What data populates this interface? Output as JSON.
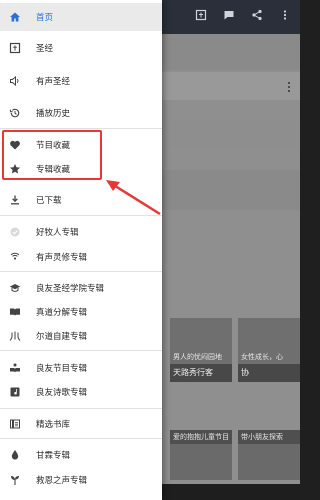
{
  "drawer": {
    "items": [
      {
        "label": "首页",
        "icon": "home-icon",
        "active": true
      },
      {
        "label": "圣经",
        "icon": "book-icon"
      },
      {
        "label": "有声圣经",
        "icon": "speaker-icon"
      },
      {
        "label": "播放历史",
        "icon": "history-icon"
      },
      {
        "label": "节目收藏",
        "icon": "heart-icon"
      },
      {
        "label": "专辑收藏",
        "icon": "star-icon"
      },
      {
        "label": "已下载",
        "icon": "download-icon"
      },
      {
        "label": "好牧人专辑",
        "icon": "shepherd-icon"
      },
      {
        "label": "有声灵修专辑",
        "icon": "radio-icon"
      },
      {
        "label": "良友圣经学院专辑",
        "icon": "graduation-cap-icon"
      },
      {
        "label": "真道分解专辑",
        "icon": "open-book-icon"
      },
      {
        "label": "尔道自建专辑",
        "icon": "script-icon"
      },
      {
        "label": "良友节目专辑",
        "icon": "reader-icon"
      },
      {
        "label": "良友诗歌专辑",
        "icon": "music-icon"
      },
      {
        "label": "精选书库",
        "icon": "library-icon"
      },
      {
        "label": "甘霖专辑",
        "icon": "drop-icon"
      },
      {
        "label": "救恩之声专辑",
        "icon": "sprout-icon"
      }
    ]
  },
  "background": {
    "thumb1_caption": "天路秀行客",
    "thumb1_subcaption": "男人的忧闷园地",
    "thumb2_subcaption": "女性成长，心",
    "thumb2_caption": "协",
    "thumb3_caption": "爱的抱抱儿童节目",
    "thumb4_caption": "带小朋友探索"
  },
  "colors": {
    "accent": "#2e6fd1",
    "annotation": "#e53935",
    "appbar": "#2a2f3a"
  }
}
